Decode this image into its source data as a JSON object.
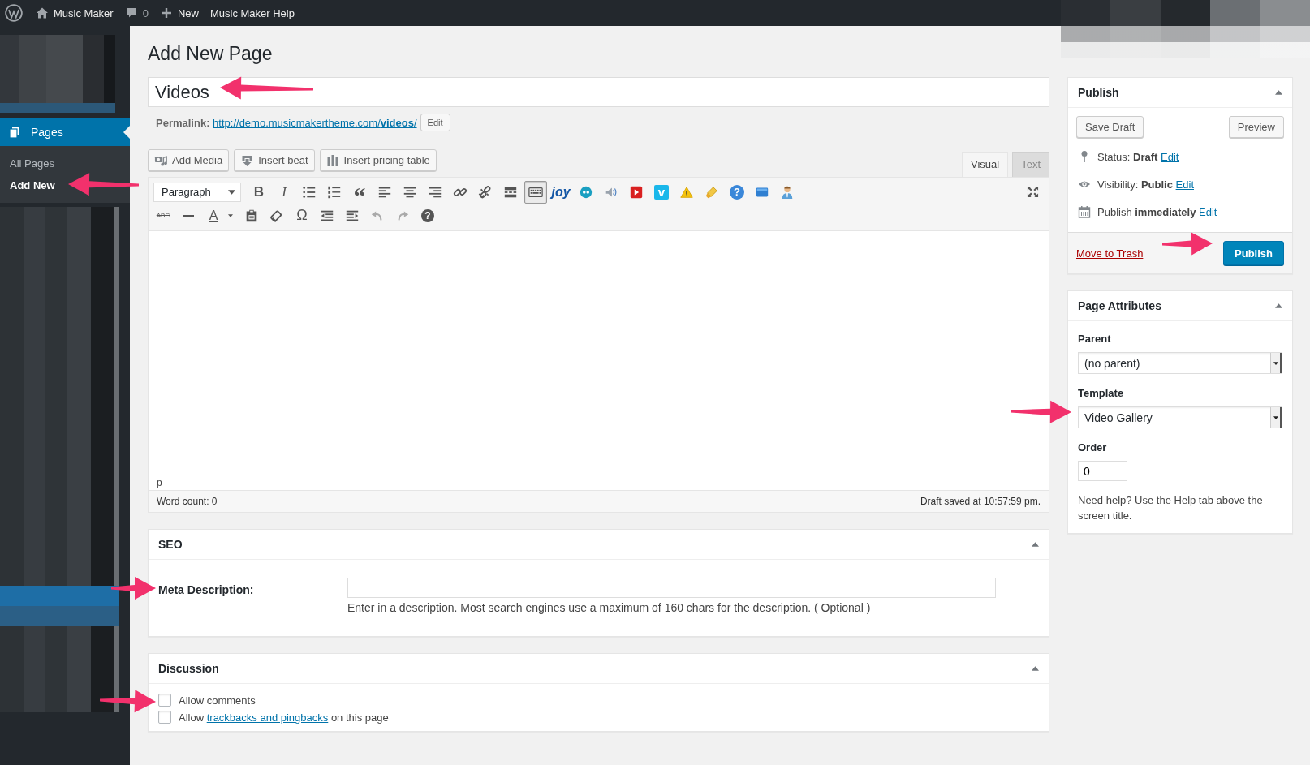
{
  "admin_bar": {
    "items": [
      {
        "kind": "logo"
      },
      {
        "kind": "home",
        "label": "Music Maker"
      },
      {
        "kind": "comments",
        "label": "0"
      },
      {
        "kind": "new",
        "label": "New"
      },
      {
        "kind": "text",
        "label": "Music Maker Help"
      }
    ]
  },
  "sidebar": {
    "menu": {
      "label": "Pages",
      "selected": true
    },
    "submenu": [
      {
        "label": "All Pages",
        "selected": false
      },
      {
        "label": "Add New",
        "selected": true
      }
    ]
  },
  "page_title": "Add New Page",
  "title_field": {
    "value": "Videos"
  },
  "permalink": {
    "label": "Permalink:",
    "url": "http://demo.musicmakertheme.com/**videos**/",
    "edit_button": "Edit"
  },
  "media_buttons": [
    {
      "kind": "media",
      "label": "Add Media"
    },
    {
      "kind": "beat",
      "label": "Insert beat"
    },
    {
      "kind": "pricing",
      "label": "Insert pricing table"
    }
  ],
  "editor_tabs": [
    {
      "label": "Visual",
      "selected": true
    },
    {
      "label": "Text",
      "selected": false
    }
  ],
  "format_select": {
    "value": "Paragraph"
  },
  "toolbar_rows": [
    [
      {
        "kind": "bold",
        "glyph": "B"
      },
      {
        "kind": "italic",
        "glyph": "I"
      },
      {
        "kind": "bullet-list"
      },
      {
        "kind": "numbered-list"
      },
      {
        "kind": "blockquote",
        "glyph": "“"
      },
      {
        "kind": "align-left"
      },
      {
        "kind": "align-center"
      },
      {
        "kind": "align-right"
      },
      {
        "kind": "link"
      },
      {
        "kind": "unlink"
      },
      {
        "kind": "read-more"
      },
      {
        "kind": "keyboard"
      },
      {
        "kind": "joy",
        "glyph": "joy"
      },
      {
        "kind": "quote-circle"
      },
      {
        "kind": "speaker"
      },
      {
        "kind": "video-player"
      },
      {
        "kind": "vimeo",
        "glyph": "v"
      },
      {
        "kind": "warning"
      },
      {
        "kind": "highlighter"
      },
      {
        "kind": "help-circle",
        "glyph": "?"
      },
      {
        "kind": "panel"
      },
      {
        "kind": "person"
      }
    ],
    [
      {
        "kind": "strikethrough",
        "glyph": "ABC"
      },
      {
        "kind": "horizontal-line"
      },
      {
        "kind": "text-color",
        "glyph": "A"
      },
      {
        "kind": "caret"
      },
      {
        "kind": "paste"
      },
      {
        "kind": "eraser"
      },
      {
        "kind": "omega",
        "glyph": "Ω"
      },
      {
        "kind": "outdent"
      },
      {
        "kind": "indent"
      },
      {
        "kind": "undo"
      },
      {
        "kind": "redo"
      },
      {
        "kind": "help",
        "glyph": "?"
      }
    ]
  ],
  "editor_status": {
    "path": "p",
    "word_count": "Word count: 0",
    "draft_saved": "Draft saved at 10:57:59 pm."
  },
  "seo": {
    "title": "SEO",
    "field_label": "Meta Description:",
    "help": "Enter in a description. Most search engines use a maximum of 160 chars for the description. ( Optional )"
  },
  "discussion": {
    "title": "Discussion",
    "options": [
      {
        "text": "Allow comments",
        "checked": false
      },
      {
        "text": "Allow ",
        "link": "trackbacks and pingbacks",
        "after": " on this page",
        "checked": false
      }
    ]
  },
  "publish": {
    "title": "Publish",
    "save_draft": "Save Draft",
    "preview": "Preview",
    "rows": [
      {
        "kind": "pin",
        "text": "Status: **Draft**",
        "link": "Edit"
      },
      {
        "kind": "eye",
        "text": "Visibility: **Public**",
        "link": "Edit"
      },
      {
        "kind": "calendar",
        "text": "Publish **immediately**",
        "link": "Edit"
      }
    ],
    "trash": "Move to Trash",
    "publish_button": "Publish"
  },
  "page_attributes": {
    "title": "Page Attributes",
    "fields": [
      {
        "kind": "select",
        "label": "Parent",
        "value": "(no parent)"
      },
      {
        "kind": "select",
        "label": "Template",
        "value": "Video Gallery"
      },
      {
        "kind": "input",
        "label": "Order",
        "value": "0"
      }
    ],
    "help": "Need help? Use the Help tab above the screen title."
  }
}
